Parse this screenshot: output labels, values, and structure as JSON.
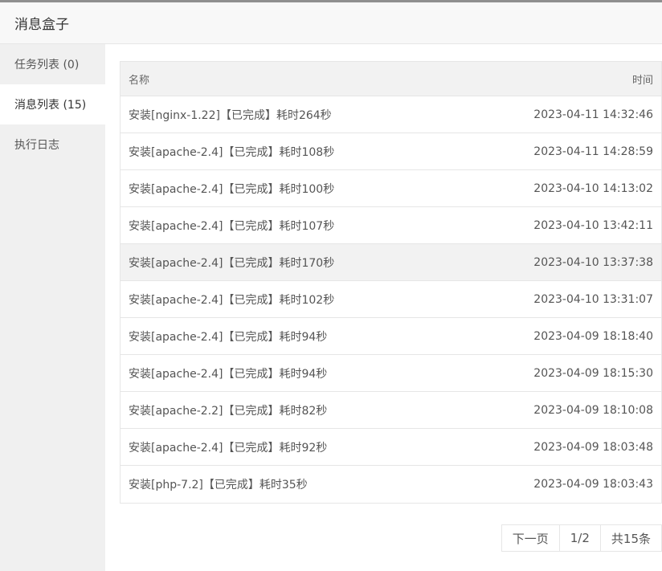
{
  "window": {
    "title": "消息盒子"
  },
  "sidebar": {
    "items": [
      {
        "label": "任务列表 (0)"
      },
      {
        "label": "消息列表 (15)"
      },
      {
        "label": "执行日志"
      }
    ]
  },
  "table": {
    "headers": {
      "name": "名称",
      "time": "时间"
    },
    "rows": [
      {
        "name": "安装[nginx-1.22]【已完成】耗时264秒",
        "time": "2023-04-11 14:32:46"
      },
      {
        "name": "安装[apache-2.4]【已完成】耗时108秒",
        "time": "2023-04-11 14:28:59"
      },
      {
        "name": "安装[apache-2.4]【已完成】耗时100秒",
        "time": "2023-04-10 14:13:02"
      },
      {
        "name": "安装[apache-2.4]【已完成】耗时107秒",
        "time": "2023-04-10 13:42:11"
      },
      {
        "name": "安装[apache-2.4]【已完成】耗时170秒",
        "time": "2023-04-10 13:37:38"
      },
      {
        "name": "安装[apache-2.4]【已完成】耗时102秒",
        "time": "2023-04-10 13:31:07"
      },
      {
        "name": "安装[apache-2.4]【已完成】耗时94秒",
        "time": "2023-04-09 18:18:40"
      },
      {
        "name": "安装[apache-2.4]【已完成】耗时94秒",
        "time": "2023-04-09 18:15:30"
      },
      {
        "name": "安装[apache-2.2]【已完成】耗时82秒",
        "time": "2023-04-09 18:10:08"
      },
      {
        "name": "安装[apache-2.4]【已完成】耗时92秒",
        "time": "2023-04-09 18:03:48"
      },
      {
        "name": "安装[php-7.2]【已完成】耗时35秒",
        "time": "2023-04-09 18:03:43"
      }
    ]
  },
  "pagination": {
    "next_label": "下一页",
    "page_indicator": "1/2",
    "total_label": "共15条"
  }
}
